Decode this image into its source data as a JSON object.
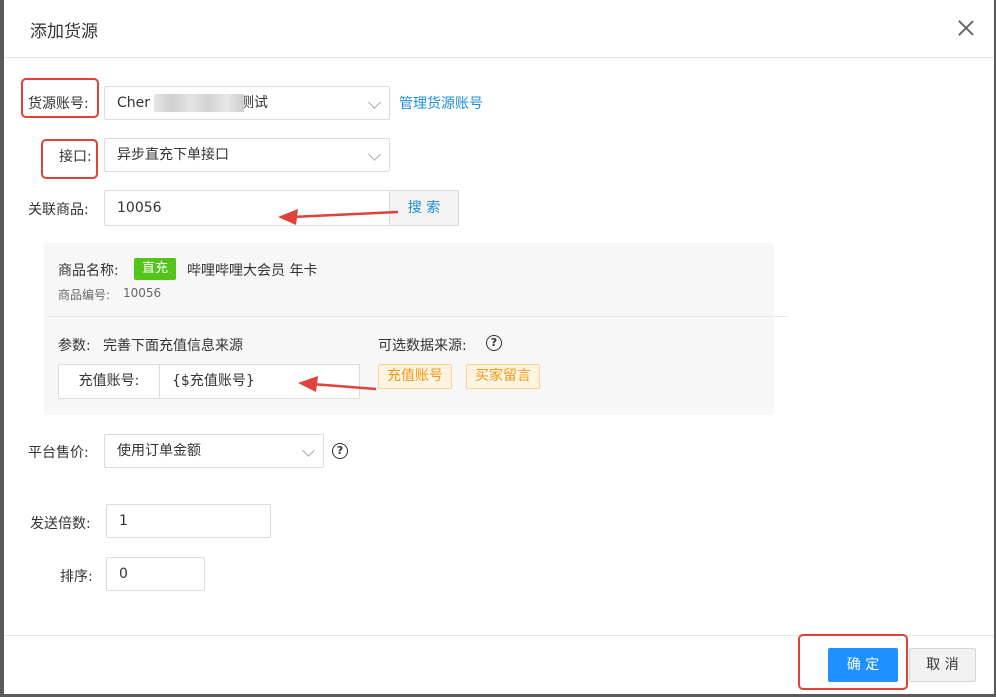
{
  "dialog": {
    "title": "添加货源",
    "close_icon": "close-icon"
  },
  "form": {
    "source_account": {
      "label": "货源账号:",
      "value_prefix": "Cher",
      "value_suffix": "测试",
      "manage_link": "管理货源账号"
    },
    "interface": {
      "label": "接口:",
      "value": "异步直充下单接口"
    },
    "linked_product": {
      "label": "关联商品:",
      "value": "10056",
      "search_button": "搜 索"
    },
    "product_info": {
      "name_label": "商品名称:",
      "tag": "直充",
      "name": "哔哩哔哩大会员 年卡",
      "code_label": "商品编号:",
      "code": "10056",
      "params_label": "参数:",
      "params_hint": "完善下面充值信息来源",
      "sources_label": "可选数据来源:",
      "recharge_account_label": "充值账号:",
      "recharge_account_value": "{$充值账号}",
      "source_tags": [
        "充值账号",
        "买家留言"
      ]
    },
    "platform_price": {
      "label": "平台售价:",
      "value": "使用订单金额"
    },
    "send_multiple": {
      "label": "发送倍数:",
      "value": "1"
    },
    "sort": {
      "label": "排序:",
      "value": "0"
    }
  },
  "footer": {
    "confirm": "确 定",
    "cancel": "取 消"
  },
  "colors": {
    "primary": "#1e90ff",
    "link": "#1e8fd8",
    "tag_green": "#52c41a",
    "tag_orange_text": "#f09a14",
    "annotation_red": "#e0413a"
  }
}
